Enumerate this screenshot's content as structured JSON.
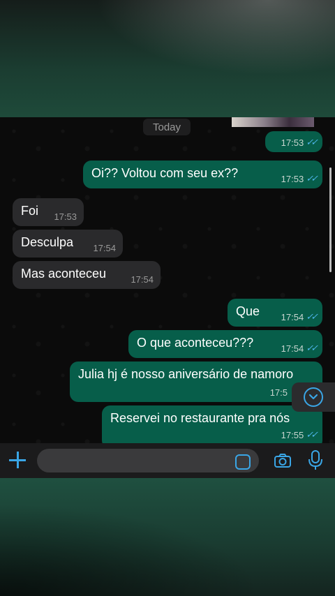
{
  "chat": {
    "date_label": "Today",
    "messages": [
      {
        "side": "out",
        "text": "",
        "time": "17:53",
        "status": "read"
      },
      {
        "side": "out",
        "text": "Oi?? Voltou com seu ex??",
        "time": "17:53",
        "status": "read"
      },
      {
        "side": "in",
        "text": "Foi",
        "time": "17:53"
      },
      {
        "side": "in",
        "text": "Desculpa",
        "time": "17:54"
      },
      {
        "side": "in",
        "text": "Mas aconteceu",
        "time": "17:54"
      },
      {
        "side": "out",
        "text": "Que",
        "time": "17:54",
        "status": "read"
      },
      {
        "side": "out",
        "text": "O que aconteceu???",
        "time": "17:54",
        "status": "read"
      },
      {
        "side": "out",
        "text": "Julia hj é nosso aniversário de namoro",
        "time": "17:5",
        "status": "read"
      },
      {
        "side": "out",
        "text": "Reservei no restaurante pra nós",
        "time": "17:55",
        "status": "read"
      }
    ]
  },
  "composer": {
    "placeholder": "",
    "icons": {
      "attach": "plus-icon",
      "sticker": "sticker-icon",
      "camera": "camera-icon",
      "mic": "microphone-icon",
      "scroll": "chevron-down-icon"
    }
  },
  "colors": {
    "outgoing_bubble": "#075e4a",
    "incoming_bubble": "#2a2a2c",
    "accent": "#3aa6e6",
    "read_ticks": "#4fb6ec"
  }
}
